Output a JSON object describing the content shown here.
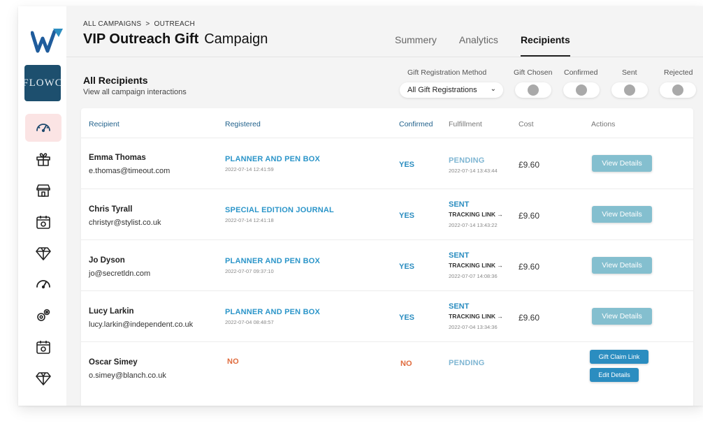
{
  "breadcrumb": {
    "root": "ALL CAMPAIGNS",
    "separator": ">",
    "current": "OUTREACH"
  },
  "page_title": {
    "bold": "VIP Outreach Gift",
    "rest": "Campaign"
  },
  "tabs": [
    {
      "label": "Summery",
      "active": false
    },
    {
      "label": "Analytics",
      "active": false
    },
    {
      "label": "Recipients",
      "active": true
    }
  ],
  "section": {
    "title": "All Recipients",
    "subtitle": "View all campaign interactions"
  },
  "filters": {
    "method_label": "Gift Registration Method",
    "method_value": "All Gift Registrations",
    "toggles": [
      "Gift Chosen",
      "Confirmed",
      "Sent",
      "Rejected"
    ]
  },
  "brand": {
    "text": "FLOWC"
  },
  "table": {
    "headers": [
      "Recipient",
      "Registered",
      "Confirmed",
      "Fulfillment",
      "Cost",
      "Actions"
    ],
    "rows": [
      {
        "name": "Emma Thomas",
        "email": "e.thomas@timeout.com",
        "gift": "PLANNER AND PEN BOX",
        "reg_ts": "2022-07-14 12:41:59",
        "confirmed": "YES",
        "fulfillment": "PENDING",
        "tracking": "",
        "ful_ts": "2022-07-14 13:43:44",
        "cost": "£9.60",
        "action": "View Details"
      },
      {
        "name": "Chris Tyrall",
        "email": "christyr@stylist.co.uk",
        "gift": "SPECIAL EDITION JOURNAL",
        "reg_ts": "2022-07-14 12:41:18",
        "confirmed": "YES",
        "fulfillment": "SENT",
        "tracking": "TRACKING LINK →",
        "ful_ts": "2022-07-14 13:43:22",
        "cost": "£9.60",
        "action": "View Details"
      },
      {
        "name": "Jo Dyson",
        "email": "jo@secretldn.com",
        "gift": "PLANNER AND PEN BOX",
        "reg_ts": "2022-07-07 09:37:10",
        "confirmed": "YES",
        "fulfillment": "SENT",
        "tracking": "TRACKING LINK →",
        "ful_ts": "2022-07-07 14:08:36",
        "cost": "£9.60",
        "action": "View Details"
      },
      {
        "name": "Lucy Larkin",
        "email": "lucy.larkin@independent.co.uk",
        "gift": "PLANNER AND PEN BOX",
        "reg_ts": "2022-07-04 08:48:57",
        "confirmed": "YES",
        "fulfillment": "SENT",
        "tracking": "TRACKING LINK →",
        "ful_ts": "2022-07-04 13:34:36",
        "cost": "£9.60",
        "action": "View Details"
      },
      {
        "name": "Oscar Simey",
        "email": "o.simey@blanch.co.uk",
        "gift": "NO",
        "reg_ts": "",
        "confirmed": "NO",
        "fulfillment": "PENDING",
        "tracking": "",
        "ful_ts": "",
        "cost": "",
        "action": "Gift Claim Link",
        "action2": "Edit Details"
      }
    ]
  },
  "icons": {
    "logo": "w-logo-icon",
    "nav": [
      "dashboard-gauge-icon",
      "gift-icon",
      "store-icon",
      "calendar-icon",
      "diamond-icon",
      "gauge-icon",
      "settings-gears-icon",
      "calendar-icon",
      "diamond-icon"
    ]
  },
  "colors": {
    "accent": "#2b8dc0",
    "button_muted": "#84bfcf",
    "warning": "#e06b3d",
    "logo_blue": "#1f5c9c",
    "brand_bg": "#1d4f6e",
    "active_nav_bg": "#fbe4e4"
  }
}
